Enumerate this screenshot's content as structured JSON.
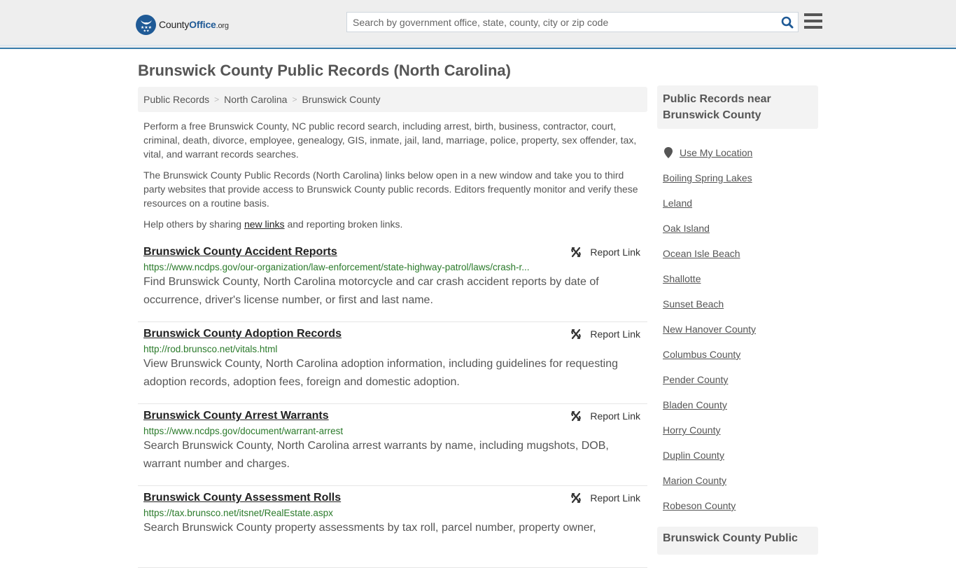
{
  "header": {
    "logo": {
      "name_part1": "County",
      "name_part2": "Office",
      "tld": ".org"
    },
    "search": {
      "placeholder": "Search by government office, state, county, city or zip code",
      "value": ""
    },
    "icons": {
      "search": "search-icon",
      "menu": "hamburger-menu-icon"
    },
    "colors": {
      "brand": "#1f5a96",
      "accent_border": "#3a7dab"
    }
  },
  "page": {
    "title": "Brunswick County Public Records (North Carolina)"
  },
  "breadcrumb": [
    {
      "label": "Public Records"
    },
    {
      "label": "North Carolina"
    },
    {
      "label": "Brunswick County"
    }
  ],
  "intro": {
    "paragraph1": "Perform a free Brunswick County, NC public record search, including arrest, birth, business, contractor, court, criminal, death, divorce, employee, genealogy, GIS, inmate, jail, land, marriage, police, property, sex offender, tax, vital, and warrant records searches.",
    "paragraph2": "The Brunswick County Public Records (North Carolina) links below open in a new window and take you to third party websites that provide access to Brunswick County public records. Editors frequently monitor and verify these resources on a routine basis.",
    "help_prefix": "Help others by sharing ",
    "help_link": "new links",
    "help_suffix": " and reporting broken links."
  },
  "records": [
    {
      "title": "Brunswick County Accident Reports",
      "url": "https://www.ncdps.gov/our-organization/law-enforcement/state-highway-patrol/laws/crash-r...",
      "description": "Find Brunswick County, North Carolina motorcycle and car crash accident reports by date of occurrence, driver's license number, or first and last name.",
      "report_label": "Report Link"
    },
    {
      "title": "Brunswick County Adoption Records",
      "url": "http://rod.brunsco.net/vitals.html",
      "description": "View Brunswick County, North Carolina adoption information, including guidelines for requesting adoption records, adoption fees, foreign and domestic adoption.",
      "report_label": "Report Link"
    },
    {
      "title": "Brunswick County Arrest Warrants",
      "url": "https://www.ncdps.gov/document/warrant-arrest",
      "description": "Search Brunswick County, North Carolina arrest warrants by name, including mugshots, DOB, warrant number and charges.",
      "report_label": "Report Link"
    },
    {
      "title": "Brunswick County Assessment Rolls",
      "url": "https://tax.brunsco.net/itsnet/RealEstate.aspx",
      "description": "Search Brunswick County property assessments by tax roll, parcel number, property owner,",
      "report_label": "Report Link"
    }
  ],
  "sidebar": {
    "heading": "Public Records near Brunswick County",
    "use_location": "Use My Location",
    "items": [
      {
        "label": "Boiling Spring Lakes"
      },
      {
        "label": "Leland"
      },
      {
        "label": "Oak Island"
      },
      {
        "label": "Ocean Isle Beach"
      },
      {
        "label": "Shallotte"
      },
      {
        "label": "Sunset Beach"
      },
      {
        "label": "New Hanover County"
      },
      {
        "label": "Columbus County"
      },
      {
        "label": "Pender County"
      },
      {
        "label": "Bladen County"
      },
      {
        "label": "Horry County"
      },
      {
        "label": "Duplin County"
      },
      {
        "label": "Marion County"
      },
      {
        "label": "Robeson County"
      }
    ],
    "heading2": "Brunswick County Public"
  }
}
